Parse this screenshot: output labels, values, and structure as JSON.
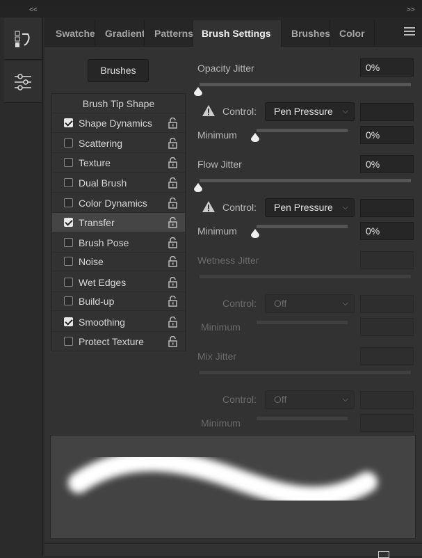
{
  "collapse": {
    "left": "<<",
    "right": ">>"
  },
  "tabs": [
    {
      "label": "Swatches"
    },
    {
      "label": "Gradients"
    },
    {
      "label": "Patterns"
    },
    {
      "label": "Brush Settings",
      "active": true
    },
    {
      "label": "Brushes"
    },
    {
      "label": "Color"
    }
  ],
  "brushes_button": "Brushes",
  "brush_tip_shape": "Brush Tip Shape",
  "options": [
    {
      "label": "Shape Dynamics",
      "checked": true
    },
    {
      "label": "Scattering",
      "checked": false
    },
    {
      "label": "Texture",
      "checked": false
    },
    {
      "label": "Dual Brush",
      "checked": false
    },
    {
      "label": "Color Dynamics",
      "checked": false
    },
    {
      "label": "Transfer",
      "checked": true,
      "selected": true
    },
    {
      "label": "Brush Pose",
      "checked": false
    },
    {
      "label": "Noise",
      "checked": false
    },
    {
      "label": "Wet Edges",
      "checked": false
    },
    {
      "label": "Build-up",
      "checked": false
    },
    {
      "label": "Smoothing",
      "checked": true
    },
    {
      "label": "Protect Texture",
      "checked": false
    }
  ],
  "opacity": {
    "label": "Opacity Jitter",
    "value": "0%",
    "control_label": "Control:",
    "control": "Pen Pressure",
    "min_label": "Minimum",
    "min_value": "0%"
  },
  "flow": {
    "label": "Flow Jitter",
    "value": "0%",
    "control_label": "Control:",
    "control": "Pen Pressure",
    "min_label": "Minimum",
    "min_value": "0%"
  },
  "wetness": {
    "label": "Wetness Jitter",
    "control_label": "Control:",
    "control": "Off",
    "min_label": "Minimum"
  },
  "mix": {
    "label": "Mix Jitter",
    "control_label": "Control:",
    "control": "Off",
    "min_label": "Minimum"
  }
}
